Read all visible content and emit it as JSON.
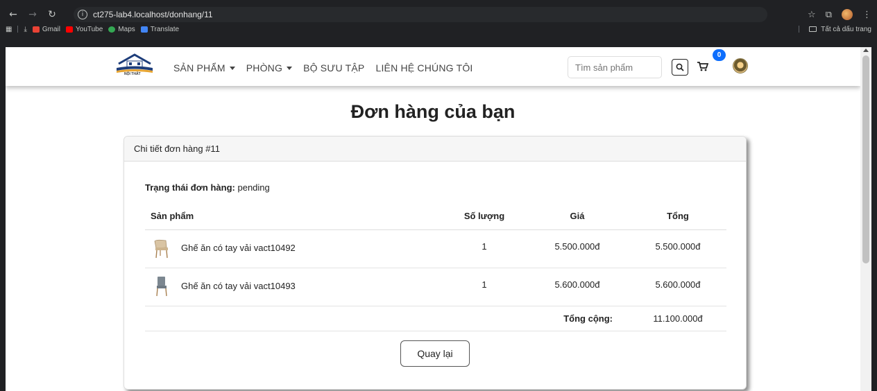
{
  "browser": {
    "url": "ct275-lab4.localhost/donhang/11",
    "bookmarks": [
      "Gmail",
      "YouTube",
      "Maps",
      "Translate"
    ],
    "all_bookmarks_label": "Tất cả dấu trang"
  },
  "navbar": {
    "logo_text": "NỘI THẤT",
    "menu": [
      {
        "label": "SẢN PHẨM",
        "dropdown": true
      },
      {
        "label": "PHÒNG",
        "dropdown": true
      },
      {
        "label": "BỘ SƯU TẬP",
        "dropdown": false
      },
      {
        "label": "LIÊN HỆ CHÚNG TÔI",
        "dropdown": false
      }
    ],
    "search_placeholder": "Tìm sản phẩm",
    "cart_count": "0"
  },
  "page": {
    "title": "Đơn hàng của bạn"
  },
  "order": {
    "header": "Chi tiết đơn hàng #11",
    "status_label": "Trạng thái đơn hàng:",
    "status_value": "pending",
    "columns": [
      "Sản phẩm",
      "Số lượng",
      "Giá",
      "Tổng"
    ],
    "items": [
      {
        "name": "Ghế ăn có tay vải vact10492",
        "qty": "1",
        "price": "5.500.000đ",
        "total": "5.500.000đ",
        "thumb": "chair-beige-icon"
      },
      {
        "name": "Ghế ăn có tay vải vact10493",
        "qty": "1",
        "price": "5.600.000đ",
        "total": "5.600.000đ",
        "thumb": "chair-grey-icon"
      }
    ],
    "grand_total_label": "Tổng cộng:",
    "grand_total": "11.100.000đ",
    "back_label": "Quay lại"
  },
  "colors": {
    "badge": "#0d6efd",
    "chrome": "#202124"
  }
}
